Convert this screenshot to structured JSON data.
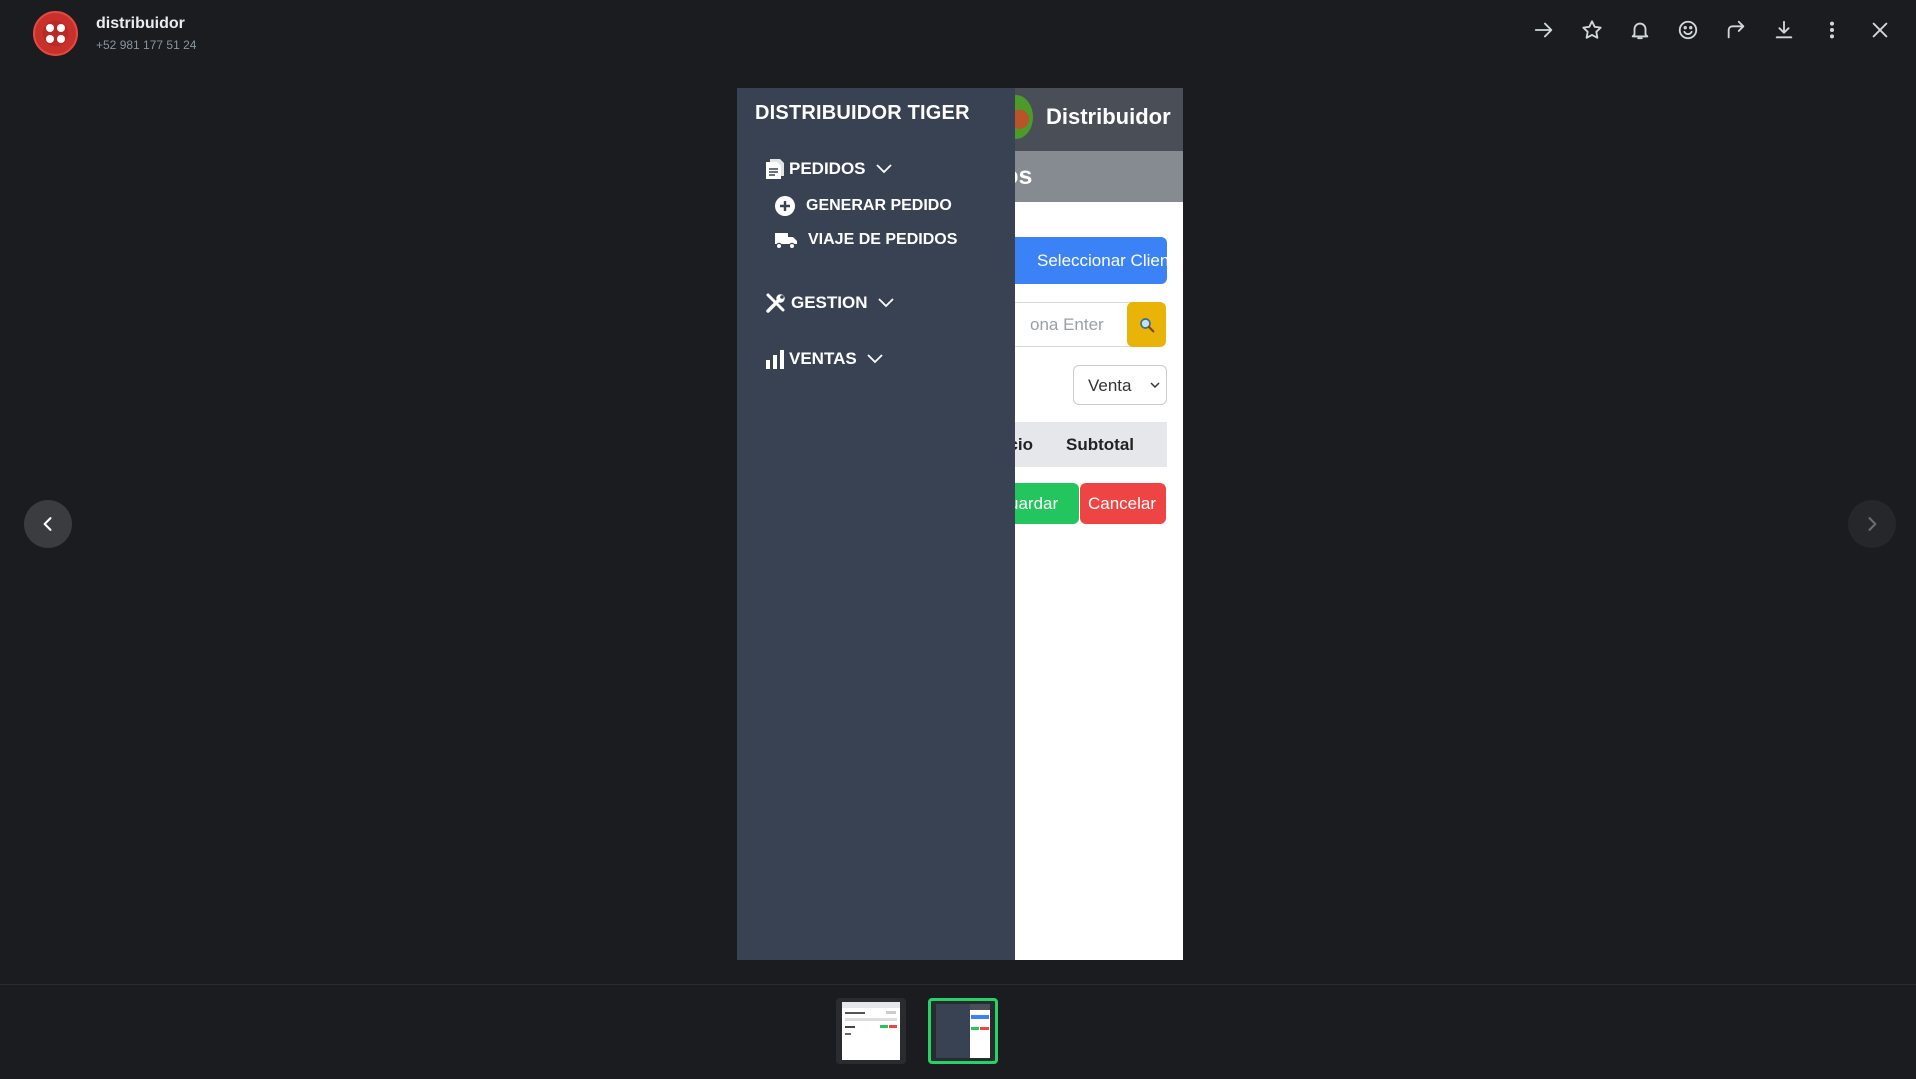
{
  "contact": {
    "name": "distribuidor",
    "phone": "+52 981 177 51 24"
  },
  "toolbar": {
    "icons": [
      "arrow-right-icon",
      "star-icon",
      "bell-icon",
      "emoji-icon",
      "forward-icon",
      "download-icon",
      "more-vertical-icon",
      "close-icon"
    ]
  },
  "app": {
    "header_title": "Distribuidor",
    "page_title": "dos",
    "select_client_label": "Seleccionar Cliente",
    "search_placeholder": "ona Enter",
    "type_select_value": "Venta",
    "table_headers": [
      "ecio",
      "Subtotal"
    ],
    "save_label": "uardar",
    "cancel_label": "Cancelar"
  },
  "drawer": {
    "title": "DISTRIBUIDOR TIGER",
    "menu": [
      {
        "label": "PEDIDOS",
        "icon": "document-icon",
        "expanded": true,
        "items": [
          {
            "label": "GENERAR PEDIDO",
            "icon": "plus-circle-icon"
          },
          {
            "label": "VIAJE DE PEDIDOS",
            "icon": "truck-icon"
          }
        ]
      },
      {
        "label": "GESTION",
        "icon": "tools-icon",
        "expanded": false
      },
      {
        "label": "VENTAS",
        "icon": "bar-chart-icon",
        "expanded": false
      }
    ]
  },
  "colors": {
    "background": "#1b1c20",
    "drawer": "#394253",
    "primary_button": "#3b82f6",
    "search_button": "#eab308",
    "save_button": "#22c55e",
    "cancel_button": "#ef4444",
    "thumbnail_selected": "#25d366"
  }
}
